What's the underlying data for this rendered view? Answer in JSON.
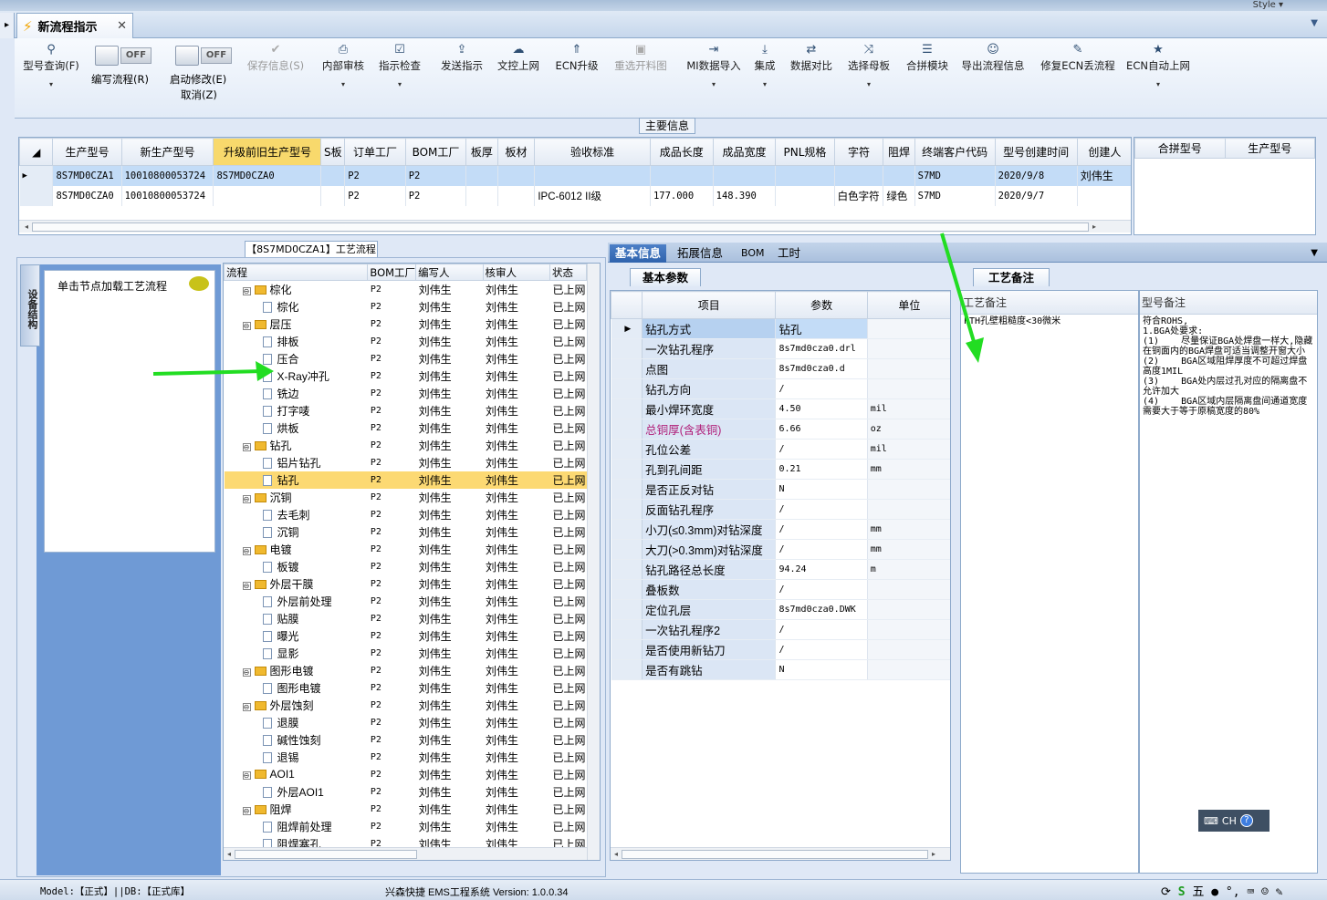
{
  "app": {
    "tab_title": "新流程指示",
    "style_label": "Style ▾"
  },
  "toolbar": [
    {
      "name": "model-query",
      "label": "型号查询(F)",
      "icon": "⚲",
      "dd": true
    },
    {
      "name": "save-info",
      "label": "保存信息(S)",
      "icon": "✔",
      "disabled": true
    },
    {
      "name": "internal-review",
      "label": "内部审核",
      "icon": "⎙",
      "dd": true
    },
    {
      "name": "instruction-check",
      "label": "指示检查",
      "icon": "☑",
      "dd": true
    },
    {
      "name": "publish-instruction",
      "label": "发送指示",
      "icon": "⇪",
      "dd": false
    },
    {
      "name": "doc-upload",
      "label": "文控上网",
      "icon": "☁",
      "dd": false
    },
    {
      "name": "ecn-upgrade",
      "label": "ECN升级",
      "icon": "⇑",
      "dd": false
    },
    {
      "name": "reselect-drawing",
      "label": "重选开料图",
      "icon": "▣",
      "disabled": true
    },
    {
      "name": "mi-import",
      "label": "MI数据导入",
      "icon": "⇥",
      "dd": true
    },
    {
      "name": "integrate",
      "label": "集成",
      "icon": "⤓",
      "dd": true
    },
    {
      "name": "data-compare",
      "label": "数据对比",
      "icon": "⇄",
      "dd": false
    },
    {
      "name": "select-mother",
      "label": "选择母板",
      "icon": "⤨",
      "dd": true
    },
    {
      "name": "merge-module",
      "label": "合拼模块",
      "icon": "☰",
      "dd": false
    },
    {
      "name": "export-flow",
      "label": "导出流程信息",
      "icon": "☺",
      "dd": false
    },
    {
      "name": "fix-ecn",
      "label": "修复ECN丢流程",
      "icon": "✎",
      "dd": false
    },
    {
      "name": "ecn-auto",
      "label": "ECN自动上网",
      "icon": "★",
      "dd": true
    }
  ],
  "toggles": {
    "write_flow": "编写流程(R)",
    "start_modify": "启动修改(E)",
    "cancel": "取消(Z)",
    "off": "OFF"
  },
  "main_info": {
    "title": "主要信息",
    "headers": [
      "生产型号",
      "新生产型号",
      "升级前旧生产型号",
      "S板",
      "订单工厂",
      "BOM工厂",
      "板厚",
      "板材",
      "验收标准",
      "成品长度",
      "成品宽度",
      "PNL规格",
      "字符",
      "阻焊",
      "终端客户代码",
      "型号创建时间",
      "创建人"
    ],
    "rows": [
      [
        "8S7MD0CZA1",
        "10010800053724",
        "8S7MD0CZA0",
        "",
        "P2",
        "P2",
        "",
        "",
        "",
        "",
        "",
        "",
        "",
        "",
        "S7MD",
        "2020/9/8",
        "刘伟生"
      ],
      [
        "8S7MD0CZA0",
        "10010800053724",
        "",
        "",
        "P2",
        "P2",
        "",
        "",
        "IPC-6012 II级",
        "177.000",
        "148.390",
        "",
        "白色字符",
        "绿色",
        "S7MD",
        "2020/9/7",
        ""
      ]
    ],
    "side_headers": [
      "合拼型号",
      "生产型号"
    ]
  },
  "left_panel": {
    "tab": "【8S7MD0CZA1】工艺流程",
    "vertical_tab": "设备结构",
    "hint": "单击节点加载工艺流程"
  },
  "tree": {
    "headers": [
      "流程",
      "BOM工厂",
      "编写人",
      "核审人",
      "状态"
    ],
    "rows": [
      {
        "lv": 1,
        "label": "棕化",
        "exp": "⊖"
      },
      {
        "lv": 2,
        "label": "棕化"
      },
      {
        "lv": 1,
        "label": "层压",
        "exp": "⊖"
      },
      {
        "lv": 2,
        "label": "排板"
      },
      {
        "lv": 2,
        "label": "压合"
      },
      {
        "lv": 2,
        "label": "X-Ray冲孔"
      },
      {
        "lv": 2,
        "label": "铣边"
      },
      {
        "lv": 2,
        "label": "打字唛"
      },
      {
        "lv": 2,
        "label": "烘板"
      },
      {
        "lv": 1,
        "label": "钻孔",
        "exp": "⊖"
      },
      {
        "lv": 2,
        "label": "铝片钻孔"
      },
      {
        "lv": 2,
        "label": "钻孔",
        "cur": true
      },
      {
        "lv": 1,
        "label": "沉铜",
        "exp": "⊖"
      },
      {
        "lv": 2,
        "label": "去毛刺"
      },
      {
        "lv": 2,
        "label": "沉铜"
      },
      {
        "lv": 1,
        "label": "电镀",
        "exp": "⊖"
      },
      {
        "lv": 2,
        "label": "板镀"
      },
      {
        "lv": 1,
        "label": "外层干膜",
        "exp": "⊖"
      },
      {
        "lv": 2,
        "label": "外层前处理"
      },
      {
        "lv": 2,
        "label": "贴膜"
      },
      {
        "lv": 2,
        "label": "曝光"
      },
      {
        "lv": 2,
        "label": "显影"
      },
      {
        "lv": 1,
        "label": "图形电镀",
        "exp": "⊖"
      },
      {
        "lv": 2,
        "label": "图形电镀"
      },
      {
        "lv": 1,
        "label": "外层蚀刻",
        "exp": "⊖"
      },
      {
        "lv": 2,
        "label": "退膜"
      },
      {
        "lv": 2,
        "label": "碱性蚀刻"
      },
      {
        "lv": 2,
        "label": "退锡"
      },
      {
        "lv": 1,
        "label": "AOI1",
        "exp": "⊖"
      },
      {
        "lv": 2,
        "label": "外层AOI1"
      },
      {
        "lv": 1,
        "label": "阻焊",
        "exp": "⊖"
      },
      {
        "lv": 2,
        "label": "阻焊前处理"
      },
      {
        "lv": 2,
        "label": "阻焊塞孔"
      }
    ],
    "bom": "P2",
    "writer": "刘伟生",
    "reviewer": "刘伟生",
    "status": "已上网"
  },
  "right_tabs": [
    "基本信息",
    "拓展信息",
    "BOM",
    "工时"
  ],
  "params": {
    "subtab": "基本参数",
    "headers": [
      "项目",
      "参数",
      "单位"
    ],
    "rows": [
      [
        "钻孔方式",
        "钻孔",
        ""
      ],
      [
        "一次钻孔程序",
        "8s7md0cza0.drl",
        ""
      ],
      [
        "点图",
        "8s7md0cza0.d",
        ""
      ],
      [
        "钻孔方向",
        "/",
        ""
      ],
      [
        "最小焊环宽度",
        "4.50",
        "mil"
      ],
      [
        "总铜厚(含表铜)",
        "6.66",
        "oz"
      ],
      [
        "孔位公差",
        "/",
        "mil"
      ],
      [
        "孔到孔间距",
        "0.21",
        "mm"
      ],
      [
        "是否正反对钻",
        "N",
        ""
      ],
      [
        "反面钻孔程序",
        "/",
        ""
      ],
      [
        "小刀(≤0.3mm)对钻深度",
        "/",
        "mm"
      ],
      [
        "大刀(>0.3mm)对钻深度",
        "/",
        "mm"
      ],
      [
        "钻孔路径总长度",
        "94.24",
        "m"
      ],
      [
        "叠板数",
        "/",
        ""
      ],
      [
        "定位孔层",
        "8s7md0cza0.DWK",
        ""
      ],
      [
        "一次钻孔程序2",
        "/",
        ""
      ],
      [
        "是否使用新钻刀",
        "/",
        ""
      ],
      [
        "是否有跳钻",
        "N",
        ""
      ]
    ]
  },
  "notes": {
    "subtab": "工艺备注",
    "col1": "工艺备注",
    "col1_text": "PTH孔壁粗糙度<30微米",
    "col2": "型号备注",
    "col2_text": "符合ROHS,\n1.BGA处要求:\n(1)    尽量保证BGA处焊盘一样大,隐藏在铜面内的BGA焊盘可适当调整开窗大小\n(2)    BGA区域阻焊厚度不可超过焊盘高度1MIL\n(3)    BGA处内层过孔对应的隔离盘不允许加大\n(4)    BGA区域内层隔离盘间通道宽度需要大于等于原稿宽度的80%"
  },
  "ime": {
    "label": "CH",
    "help": "?"
  },
  "status": {
    "left": "Model:【正式】||DB:【正式库】",
    "center": "兴森快捷 EMS工程系统 Version: 1.0.0.34"
  },
  "colors": {
    "accent": "#2f63ad",
    "highlight": "#f8d96c",
    "arrow": "#22dd22"
  }
}
